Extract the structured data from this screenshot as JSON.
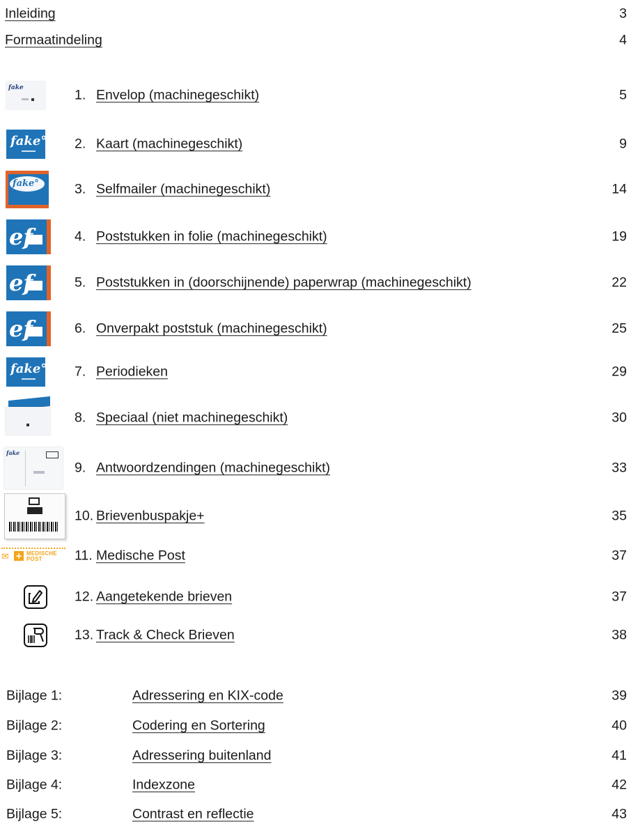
{
  "toc": {
    "intro": {
      "title": "Inleiding",
      "page": "3"
    },
    "format": {
      "title": "Formaatindeling",
      "page": "4"
    },
    "chapters": [
      {
        "num": "1.",
        "title": "Envelop (machinegeschikt)",
        "page": "5",
        "thumb": "envelope-thumbnail",
        "logo": "fake"
      },
      {
        "num": "2.",
        "title": "Kaart (machinegeschikt)",
        "page": "9",
        "thumb": "card-thumbnail",
        "logo": "fake°"
      },
      {
        "num": "3.",
        "title": "Selfmailer (machinegeschikt)",
        "page": "14",
        "thumb": "selfmailer-thumbnail",
        "logo": "fake°"
      },
      {
        "num": "4.",
        "title": "Poststukken in folie (machinegeschikt)",
        "page": "19",
        "thumb": "ef-thumbnail",
        "logo": "ef"
      },
      {
        "num": "5.",
        "title": "Poststukken in (doorschijnende) paperwrap (machinegeschikt)",
        "page": "22",
        "thumb": "ef-thumbnail",
        "logo": "ef"
      },
      {
        "num": "6.",
        "title": "Onverpakt poststuk (machinegeschikt)",
        "page": "25",
        "thumb": "ef-thumbnail",
        "logo": "ef"
      },
      {
        "num": "7.",
        "title": "Periodieken",
        "page": "29",
        "thumb": "card-thumbnail",
        "logo": "fake°"
      },
      {
        "num": "8.",
        "title": "Speciaal (niet machinegeschikt)",
        "page": "30",
        "thumb": "special-thumbnail"
      },
      {
        "num": "9.",
        "title": "Antwoordzendingen (machinegeschikt)",
        "page": "33",
        "thumb": "reply-thumbnail",
        "logo": "fake"
      },
      {
        "num": "10.",
        "title": "Brievenbuspakje+",
        "page": "35",
        "thumb": "parcel-thumbnail"
      },
      {
        "num": "11.",
        "title": "Medische Post",
        "page": "37",
        "thumb": "medical-post-thumbnail",
        "label_line1": "MEDISCHE",
        "label_line2": "POST"
      },
      {
        "num": "12.",
        "title": "Aangetekende brieven",
        "page": "37",
        "thumb": "registered-letter-icon"
      },
      {
        "num": "13.",
        "title": "Track & Check Brieven",
        "page": "38",
        "thumb": "barcode-scanner-icon"
      }
    ],
    "appendices": [
      {
        "label": "Bijlage 1:",
        "title": "Adressering en KIX-code",
        "page": "39"
      },
      {
        "label": "Bijlage 2:",
        "title": "Codering en Sortering",
        "page": "40"
      },
      {
        "label": "Bijlage 3:",
        "title": "Adressering buitenland",
        "page": "41"
      },
      {
        "label": "Bijlage 4:",
        "title": "Indexzone",
        "page": "42"
      },
      {
        "label": "Bijlage 5:",
        "title": "Contrast en reflectie",
        "page": "43"
      }
    ]
  },
  "colors": {
    "blue": "#1f74b8",
    "orange": "#e1632a",
    "medical": "#f2a51b",
    "text": "#1a1a1a"
  }
}
